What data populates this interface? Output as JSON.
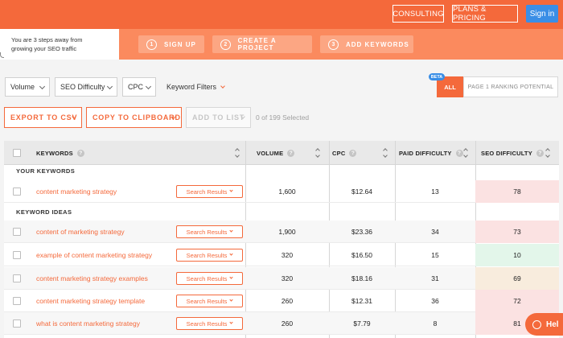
{
  "header": {
    "consulting_label": "CONSULTING",
    "plans_label": "PLANS & PRICING",
    "signin_label": "Sign in"
  },
  "steps": {
    "intro_line1": "You are 3 steps away from",
    "intro_line2": "growing your SEO traffic",
    "items": [
      {
        "num": "1",
        "label": "SIGN UP"
      },
      {
        "num": "2",
        "label": "CREATE A PROJECT"
      },
      {
        "num": "3",
        "label": "ADD KEYWORDS"
      }
    ]
  },
  "filters": {
    "volume_label": "Volume",
    "seo_difficulty_label": "SEO Difficulty",
    "cpc_label": "CPC",
    "keyword_filters_label": "Keyword Filters",
    "beta_badge": "BETA",
    "all_label": "ALL",
    "page1_label": "PAGE 1 RANKING POTENTIAL"
  },
  "actions": {
    "export_label": "EXPORT TO CSV",
    "copy_label": "COPY TO CLIPBOARD",
    "add_label": "ADD TO LIST",
    "selected_text": "0 of 199 Selected"
  },
  "table": {
    "columns": {
      "keywords": "KEYWORDS",
      "volume": "VOLUME",
      "cpc": "CPC",
      "paid_difficulty": "PAID DIFFICULTY",
      "seo_difficulty": "SEO DIFFICULTY"
    },
    "info_glyph": "?",
    "search_results_label": "Search Results",
    "your_keywords_heading": "YOUR KEYWORDS",
    "keyword_ideas_heading": "KEYWORD IDEAS",
    "your_keywords": [
      {
        "keyword": "content marketing strategy",
        "volume": "1,600",
        "cpc": "$12.64",
        "paid_difficulty": "13",
        "seo_difficulty": "78",
        "seo_color": "#fbe2e2"
      }
    ],
    "keyword_ideas": [
      {
        "keyword": "content of marketing strategy",
        "volume": "1,900",
        "cpc": "$23.36",
        "paid_difficulty": "34",
        "seo_difficulty": "73",
        "seo_color": "#fbe2e2"
      },
      {
        "keyword": "example of content marketing strategy",
        "volume": "320",
        "cpc": "$16.50",
        "paid_difficulty": "15",
        "seo_difficulty": "10",
        "seo_color": "#e3f6ea"
      },
      {
        "keyword": "content marketing strategy examples",
        "volume": "320",
        "cpc": "$18.16",
        "paid_difficulty": "31",
        "seo_difficulty": "69",
        "seo_color": "#f8ecdd"
      },
      {
        "keyword": "content marketing strategy template",
        "volume": "260",
        "cpc": "$12.31",
        "paid_difficulty": "36",
        "seo_difficulty": "72",
        "seo_color": "#fbe2e2"
      },
      {
        "keyword": "what is content marketing strategy",
        "volume": "260",
        "cpc": "$7.79",
        "paid_difficulty": "8",
        "seo_difficulty": "81",
        "seo_color": "#fbe2e2"
      }
    ]
  },
  "chat": {
    "label": "Hel"
  },
  "colors": {
    "accent": "#f4693b",
    "header_bg": "#f4693b",
    "steps_bg": "#fb8a5e",
    "signin_bg": "#3a8ee6"
  }
}
